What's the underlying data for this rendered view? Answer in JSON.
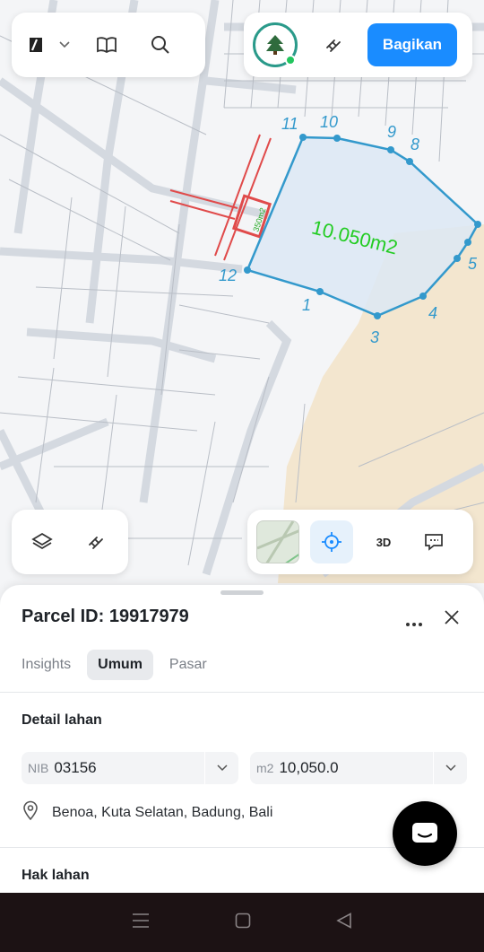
{
  "map": {
    "area_label": "10.050m2",
    "small_parcel_label": "350m2",
    "vertex_labels": [
      "11",
      "10",
      "9",
      "8",
      "12",
      "1",
      "3",
      "4",
      "5"
    ],
    "parcel_color": "#3399cc",
    "label_color": "#22cc22",
    "road_highlight_color": "#e04a4a"
  },
  "top_toolbar": {
    "logo_icon": "app-logo-icon",
    "menu_icon": "chevron-down-icon",
    "guide_icon": "book-icon",
    "search_icon": "search-icon"
  },
  "top_right": {
    "avatar_icon": "tree-avatar-icon",
    "status_color": "#22c55e",
    "measure_icon": "ruler-icon",
    "share_label": "Bagikan"
  },
  "map_controls": {
    "layers_icon": "layers-icon",
    "measure_icon": "ruler-icon",
    "basemap_icon": "map-thumbnail-icon",
    "locate_icon": "crosshair-icon",
    "three_d_label": "3D",
    "feedback_icon": "chat-bubble-icon"
  },
  "sheet": {
    "title": "Parcel ID: 19917979",
    "tabs": [
      {
        "label": "Insights",
        "active": false
      },
      {
        "label": "Umum",
        "active": true
      },
      {
        "label": "Pasar",
        "active": false
      }
    ],
    "detail_title": "Detail lahan",
    "nib_prefix": "NIB",
    "nib_value": "03156",
    "area_prefix": "m2",
    "area_value": "10,050.0",
    "address": "Benoa, Kuta Selatan, Badung, Bali",
    "rights_title": "Hak lahan"
  },
  "system_nav": {
    "menu_icon": "menu-icon",
    "home_icon": "home-icon",
    "back_icon": "back-icon"
  }
}
